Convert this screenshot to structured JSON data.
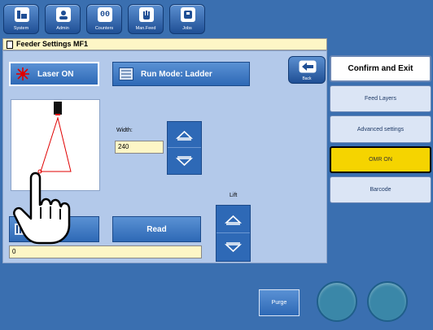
{
  "toolbar": {
    "items": [
      {
        "label": "System"
      },
      {
        "label": "Admin"
      },
      {
        "label": "Counters"
      },
      {
        "label": "Man.Feed"
      },
      {
        "label": "Jobs"
      }
    ]
  },
  "window": {
    "title": "Feeder Settings MF1"
  },
  "main": {
    "laser_button": "Laser ON",
    "run_mode_button": "Run Mode: Ladder",
    "back_button": "Back",
    "width_label": "Width:",
    "width_value": "240",
    "lift_label": "Lift",
    "read_button": "Read",
    "read_value": "0"
  },
  "right": {
    "confirm": "Confirm and Exit",
    "feed_layers": "Feed Layers",
    "advanced": "Advanced settings",
    "omr": "OMR ON",
    "barcode": "Barcode"
  },
  "bottom": {
    "purge": "Purge"
  },
  "colors": {
    "background": "#3a6fb0",
    "panel": "#b3c9ea",
    "field": "#fdf6c6",
    "omr_highlight": "#f5d400",
    "laser_red": "#e00000"
  }
}
